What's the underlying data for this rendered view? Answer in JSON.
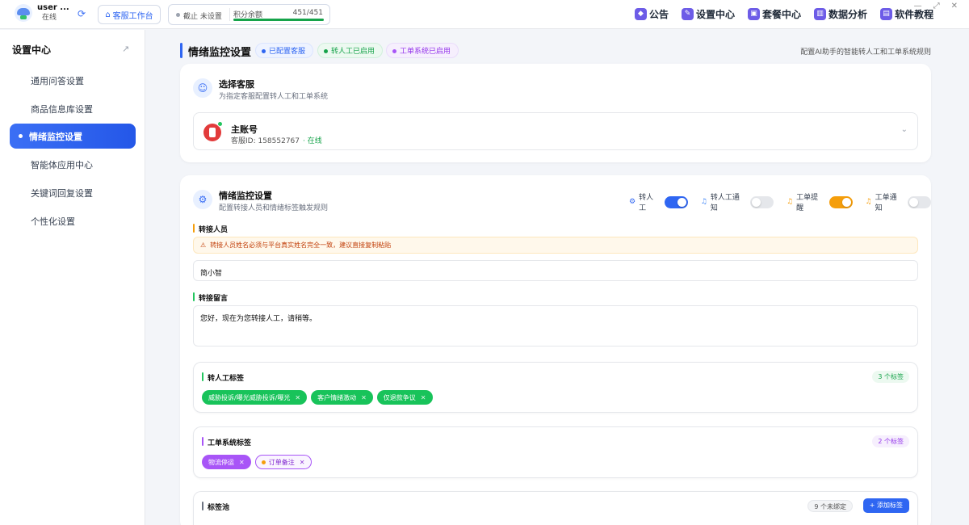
{
  "header": {
    "user_name": "user ...",
    "user_status": "在线",
    "workbench_label": "客服工作台",
    "expiry_label": "截止 未设置",
    "points_label": "积分余额",
    "points_value": "451/451",
    "points_fraction": 1.0,
    "nav": [
      {
        "label": "公告",
        "icon": "megaphone-icon"
      },
      {
        "label": "设置中心",
        "icon": "pencil-icon"
      },
      {
        "label": "套餐中心",
        "icon": "box-icon"
      },
      {
        "label": "数据分析",
        "icon": "bar-chart-icon"
      },
      {
        "label": "软件教程",
        "icon": "book-icon"
      }
    ],
    "nav_color": "#6d5ce7"
  },
  "sidebar": {
    "title": "设置中心",
    "items": [
      {
        "label": "通用问答设置"
      },
      {
        "label": "商品信息库设置"
      },
      {
        "label": "情绪监控设置"
      },
      {
        "label": "智能体应用中心"
      },
      {
        "label": "关键词回复设置"
      },
      {
        "label": "个性化设置"
      }
    ],
    "active_index": 2,
    "accent": "#2f66f2"
  },
  "page": {
    "title": "情绪监控设置",
    "pills": [
      "已配置客服",
      "转人工已启用",
      "工单系统已启用"
    ],
    "subtitle": "配置AI助手的智能转人工和工单系统规则"
  },
  "select_agent": {
    "title": "选择客服",
    "subtitle": "为指定客服配置转人工和工单系统",
    "agent_name": "主账号",
    "agent_id": "客服ID: 158552767",
    "agent_online": "在线"
  },
  "monitor": {
    "title": "情绪监控设置",
    "subtitle": "配置转接人员和情绪标签触发规则",
    "toggles": [
      {
        "label": "转人工",
        "on": true,
        "color": "#2f66f2"
      },
      {
        "label": "转人工通知",
        "on": false,
        "color": "#e5e7eb"
      },
      {
        "label": "工单提醒",
        "on": true,
        "color": "#f59e0b"
      },
      {
        "label": "工单通知",
        "on": false,
        "color": "#e5e7eb"
      }
    ],
    "transfer_person_label": "转接人员",
    "warning": "转接人员姓名必须与平台真实姓名完全一致，建议直接复制粘贴",
    "transfer_person_value": "简小智",
    "transfer_msg_label": "转接留言",
    "transfer_msg_value": "您好，现在为您转接人工，请稍等。",
    "human_tags": {
      "title": "转人工标签",
      "count": "3 个标签",
      "tags": [
        "威胁投诉/曝光威胁投诉/曝光",
        "客户情绪激动",
        "仅退款争议"
      ]
    },
    "ticket_tags": {
      "title": "工单系统标签",
      "count": "2 个标签",
      "tags": [
        "物流停运",
        "订单备注"
      ]
    },
    "tag_pool": {
      "title": "标签池",
      "unbound": "9 个未绑定",
      "add_label": "+ 添加标签"
    }
  }
}
